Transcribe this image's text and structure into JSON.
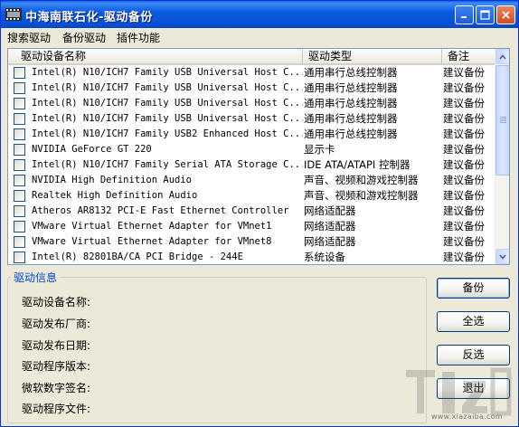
{
  "window": {
    "title": "中海南联石化-驱动备份",
    "icon": "film-strip-icon"
  },
  "menu": [
    "搜索驱动",
    "备份驱动",
    "插件功能"
  ],
  "list": {
    "columns": [
      "驱动设备名称",
      "驱动类型",
      "备注"
    ],
    "rows": [
      {
        "name": "Intel(R) N10/ICH7 Family USB Universal Host C...",
        "type": "通用串行总线控制器",
        "note": "建议备份"
      },
      {
        "name": "Intel(R) N10/ICH7 Family USB Universal Host C...",
        "type": "通用串行总线控制器",
        "note": "建议备份"
      },
      {
        "name": "Intel(R) N10/ICH7 Family USB Universal Host C...",
        "type": "通用串行总线控制器",
        "note": "建议备份"
      },
      {
        "name": "Intel(R) N10/ICH7 Family USB Universal Host C...",
        "type": "通用串行总线控制器",
        "note": "建议备份"
      },
      {
        "name": "Intel(R) N10/ICH7 Family USB2 Enhanced Host C...",
        "type": "通用串行总线控制器",
        "note": "建议备份"
      },
      {
        "name": "NVIDIA GeForce GT 220",
        "type": "显示卡",
        "note": "建议备份"
      },
      {
        "name": "Intel(R) N10/ICH7 Family Serial ATA Storage C...",
        "type": "IDE ATA/ATAPI 控制器",
        "note": "建议备份"
      },
      {
        "name": "NVIDIA High Definition Audio",
        "type": "声音、视频和游戏控制器",
        "note": "建议备份"
      },
      {
        "name": "Realtek High Definition Audio",
        "type": "声音、视频和游戏控制器",
        "note": "建议备份"
      },
      {
        "name": "Atheros AR8132 PCI-E Fast Ethernet Controller",
        "type": "网络适配器",
        "note": "建议备份"
      },
      {
        "name": "VMware Virtual Ethernet Adapter for VMnet1",
        "type": "网络适配器",
        "note": "建议备份"
      },
      {
        "name": "VMware Virtual Ethernet Adapter for VMnet8",
        "type": "网络适配器",
        "note": "建议备份"
      },
      {
        "name": "Intel(R) 82801BA/CA PCI Bridge - 244E",
        "type": "系统设备",
        "note": "建议备份"
      }
    ]
  },
  "info": {
    "title": "驱动信息",
    "labels": [
      "驱动设备名称:",
      "驱动发布厂商:",
      "驱动发布日期:",
      "驱动程序版本:",
      "微软数字签名:",
      "驱动程序文件:"
    ]
  },
  "buttons": {
    "backup": "备份",
    "select_all": "全选",
    "invert": "反选",
    "exit": "退出"
  },
  "watermark": {
    "text": "www.xiazaiba.com",
    "icon": "download-logo-icon"
  },
  "colors": {
    "titlebar": "#0b5ae0",
    "group_title": "#0046d5",
    "close_button": "#d24a1f"
  }
}
